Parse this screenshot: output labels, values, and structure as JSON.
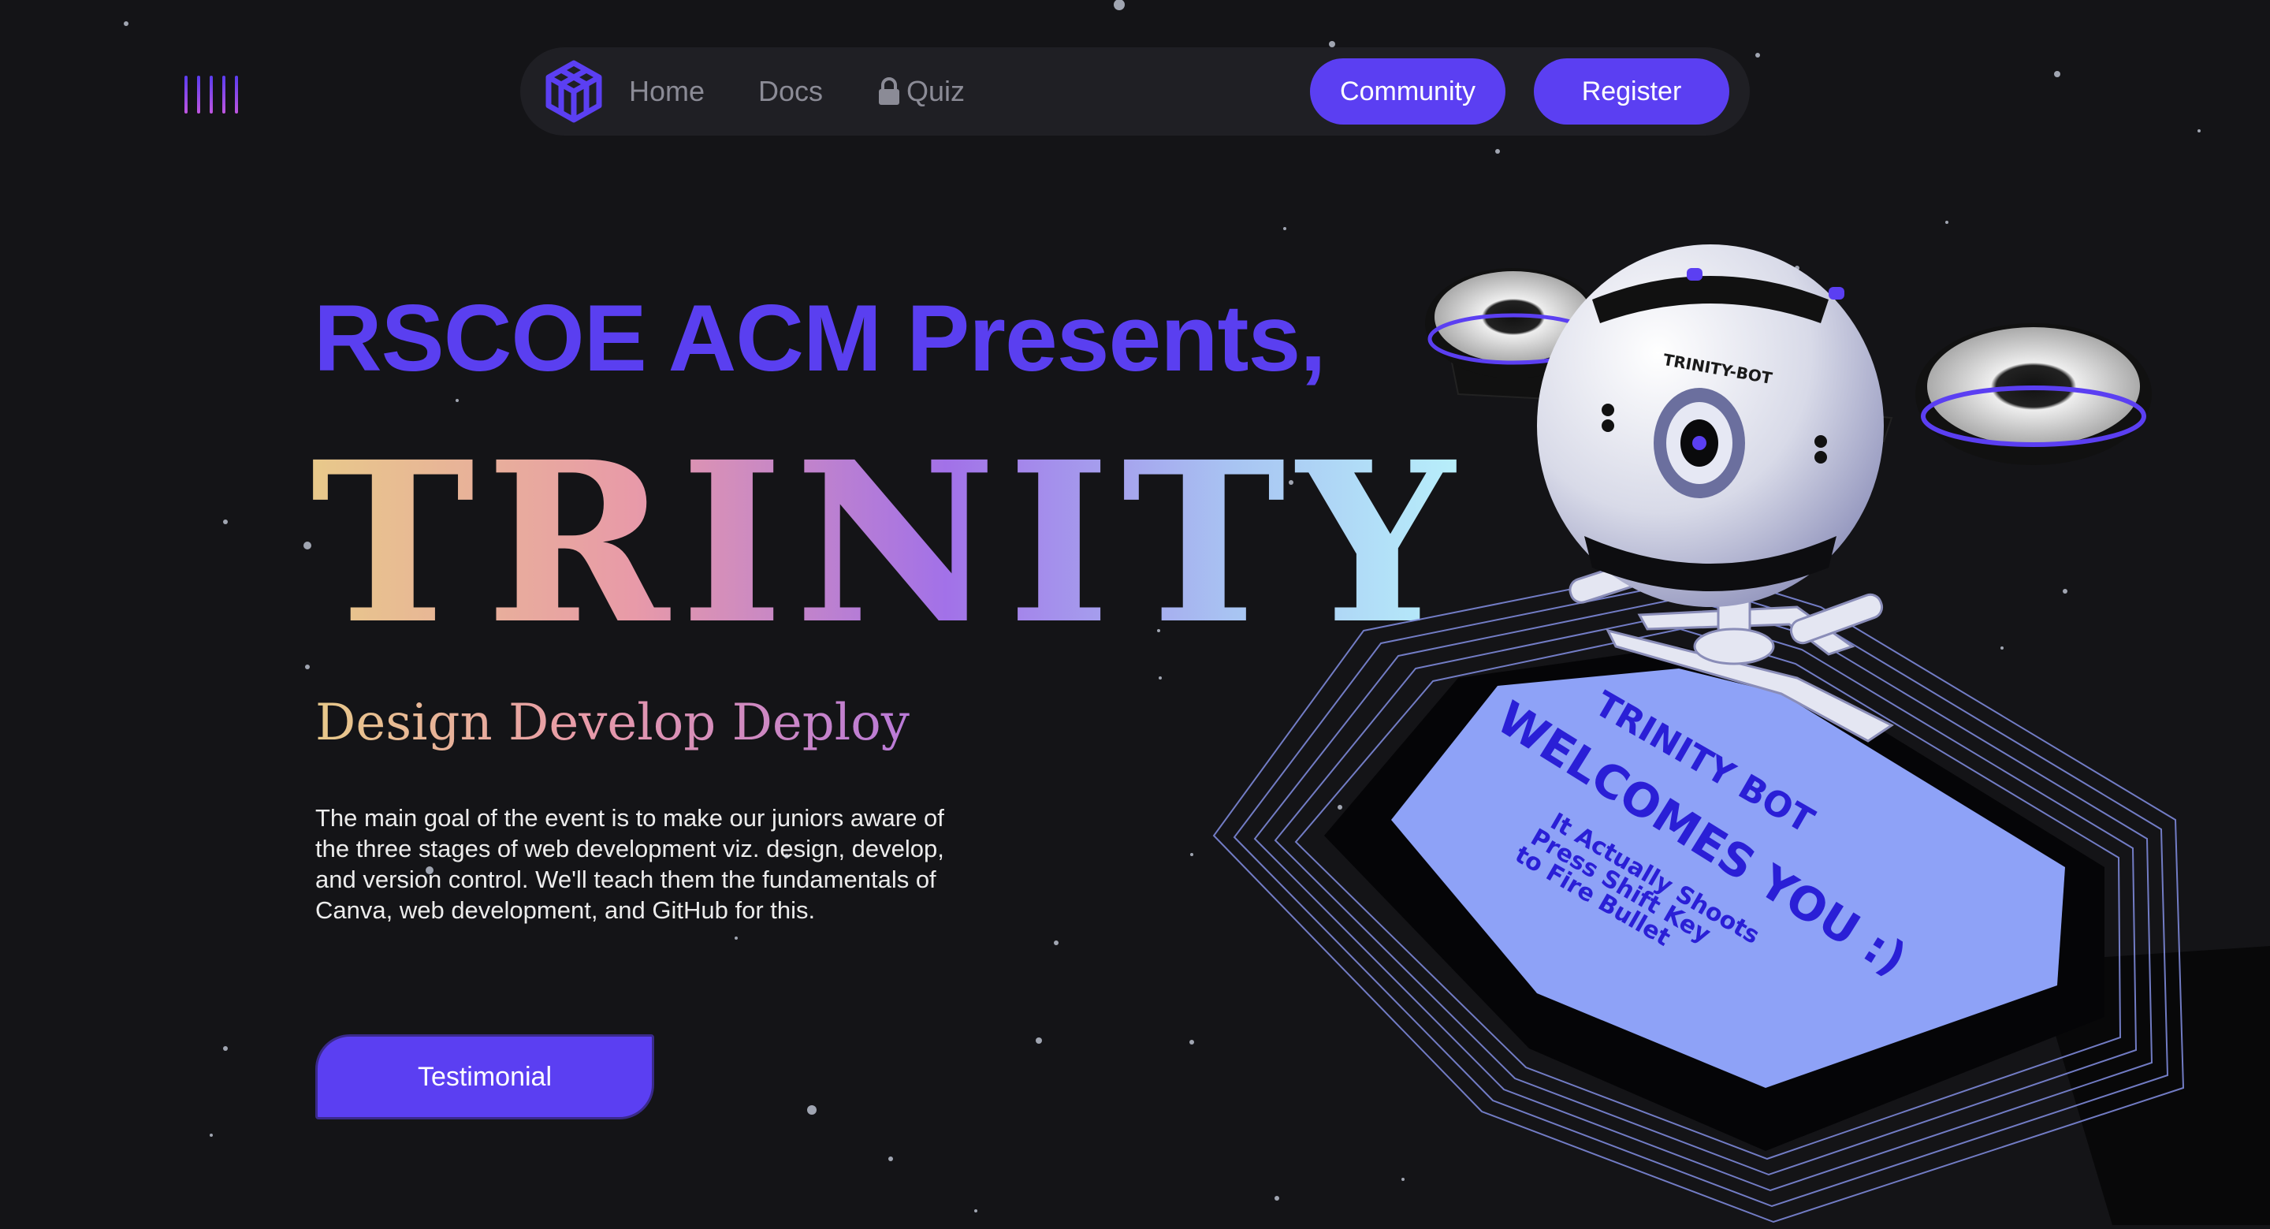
{
  "nav": {
    "home": "Home",
    "docs": "Docs",
    "quiz": "Quiz",
    "community": "Community",
    "register": "Register"
  },
  "hero": {
    "presents": "RSCOE ACM Presents,",
    "title": "TRINITY",
    "tagline": "Design Develop Deploy",
    "description": "The main goal of the event is to make our juniors aware of the three stages of web development viz. design, develop, and version control. We'll teach them the fundamentals of Canva, web development, and GitHub for this.",
    "cta": "Testimonial"
  },
  "scene": {
    "bot_label": "TRINITY-BOT",
    "platform_line1": "TRINITY BOT",
    "platform_line2": "WELCOMES YOU :)",
    "platform_line3": "It Actually Shoots",
    "platform_line4": "Press Shift Key",
    "platform_line5": "to Fire Bullet"
  },
  "colors": {
    "accent": "#5b3ff2",
    "background": "#141417",
    "nav_bg": "#1f1f24",
    "platform": "#8ea2f7"
  },
  "icons": [
    "menu-icon",
    "acm-logo-icon",
    "lock-icon"
  ]
}
